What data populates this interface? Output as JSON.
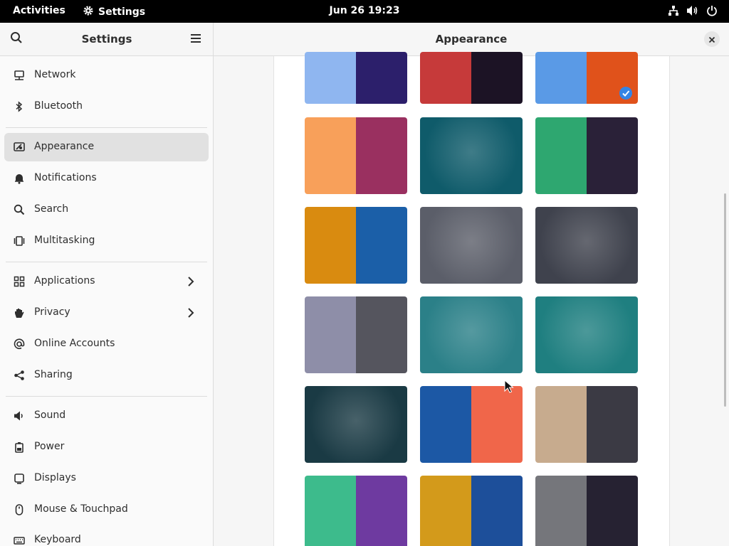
{
  "topbar": {
    "activities": "Activities",
    "app_name": "Settings",
    "clock": "Jun 26  19:23"
  },
  "sidebar": {
    "title": "Settings",
    "items": [
      {
        "label": "Network",
        "icon": "network-icon"
      },
      {
        "label": "Bluetooth",
        "icon": "bluetooth-icon"
      },
      {
        "label": "Appearance",
        "icon": "appearance-icon",
        "active": true
      },
      {
        "label": "Notifications",
        "icon": "bell-icon"
      },
      {
        "label": "Search",
        "icon": "search-icon"
      },
      {
        "label": "Multitasking",
        "icon": "multitasking-icon"
      },
      {
        "label": "Applications",
        "icon": "grid-icon",
        "has_submenu": true
      },
      {
        "label": "Privacy",
        "icon": "hand-icon",
        "has_submenu": true
      },
      {
        "label": "Online Accounts",
        "icon": "at-icon"
      },
      {
        "label": "Sharing",
        "icon": "share-icon"
      },
      {
        "label": "Sound",
        "icon": "speaker-icon"
      },
      {
        "label": "Power",
        "icon": "battery-icon"
      },
      {
        "label": "Displays",
        "icon": "display-icon"
      },
      {
        "label": "Mouse & Touchpad",
        "icon": "mouse-icon"
      },
      {
        "label": "Keyboard",
        "icon": "keyboard-icon"
      }
    ]
  },
  "main": {
    "title": "Appearance"
  },
  "wallpapers": [
    {
      "name": "blobs",
      "left_color": "#8fb6f0",
      "right_color": "#2c1f6b",
      "selected": false
    },
    {
      "name": "dark-pink",
      "left_color": "#c63a3a",
      "right_color": "#1c1325",
      "selected": false
    },
    {
      "name": "drool",
      "left_color": "#5a9ae6",
      "right_color": "#e0521b",
      "selected": true
    },
    {
      "name": "gradient",
      "left_color": "#f8a05a",
      "right_color": "#9a3060",
      "selected": false
    },
    {
      "name": "teal-nebula",
      "left_color": "#0f5b6a",
      "right_color": "#0f5b6a",
      "selected": false
    },
    {
      "name": "pattern",
      "left_color": "#2ea770",
      "right_color": "#2a2138",
      "selected": false
    },
    {
      "name": "mosaic",
      "left_color": "#d98b10",
      "right_color": "#1b5fa8",
      "selected": false
    },
    {
      "name": "debian-gray",
      "left_color": "#5b5e69",
      "right_color": "#5b5e69",
      "selected": false
    },
    {
      "name": "debian-dark",
      "left_color": "#3f424d",
      "right_color": "#3f424d",
      "selected": false
    },
    {
      "name": "scales",
      "left_color": "#8e8ea8",
      "right_color": "#55555e",
      "selected": false
    },
    {
      "name": "debian-teal",
      "left_color": "#2b8088",
      "right_color": "#2b8088",
      "selected": false
    },
    {
      "name": "debian-teal-swirl",
      "left_color": "#1f7f80",
      "right_color": "#1f7f80",
      "selected": false
    },
    {
      "name": "moon",
      "left_color": "#1a3a44",
      "right_color": "#1a3a44",
      "selected": false
    },
    {
      "name": "stripes",
      "left_color": "#1c58a5",
      "right_color": "#f0664a",
      "selected": false
    },
    {
      "name": "objects",
      "left_color": "#c7ab8e",
      "right_color": "#3b3a44",
      "selected": false
    },
    {
      "name": "green-purple",
      "left_color": "#3dbb8c",
      "right_color": "#6e3aa0",
      "selected": false
    },
    {
      "name": "hexagons",
      "left_color": "#d39a1b",
      "right_color": "#1d4f9a",
      "selected": false
    },
    {
      "name": "gray-dark",
      "left_color": "#75767b",
      "right_color": "#262232",
      "selected": false
    }
  ],
  "colors": {
    "accent": "#3584e4",
    "sidebar_active": "#e1e1e1"
  }
}
